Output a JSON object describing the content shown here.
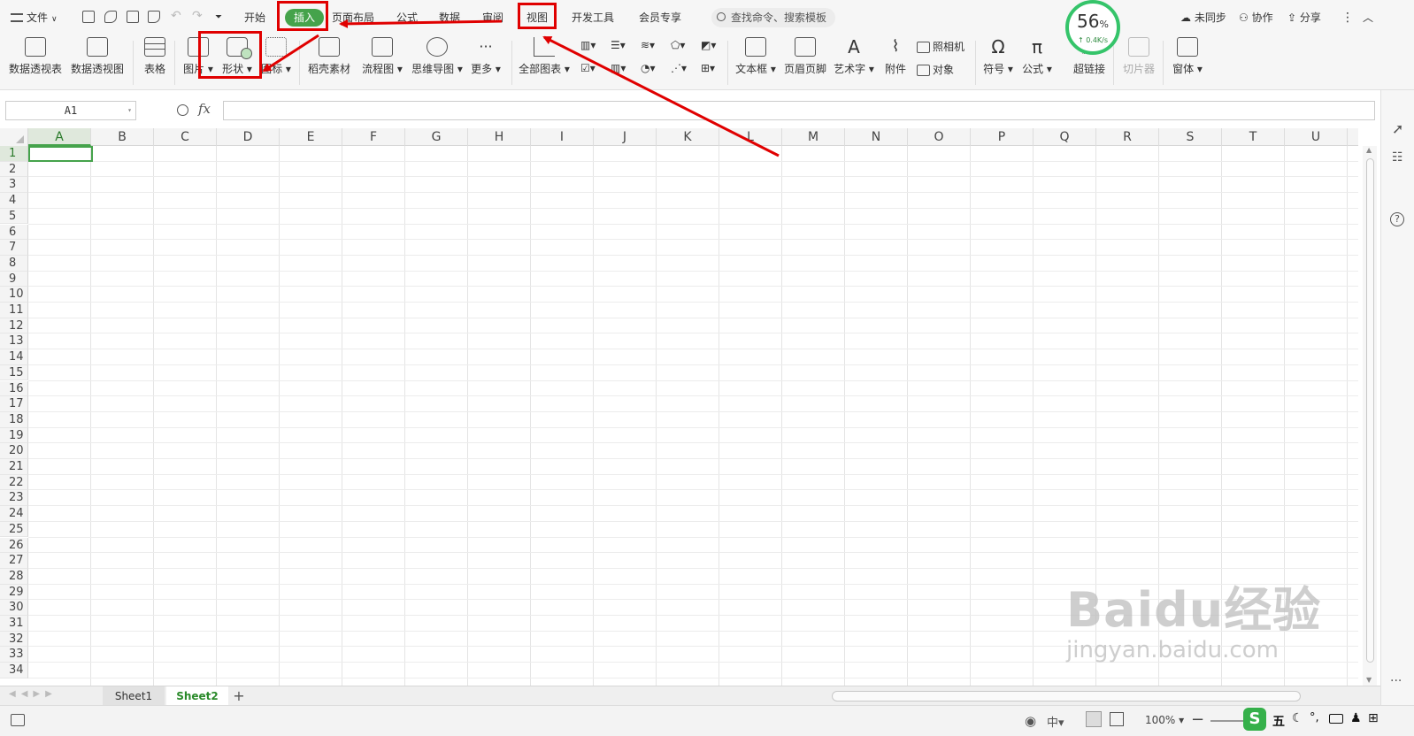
{
  "menubar": {
    "file": "文件",
    "tabs": [
      "开始",
      "插入",
      "页面布局",
      "公式",
      "数据",
      "审阅",
      "视图",
      "开发工具",
      "会员专享"
    ],
    "active_tab": "插入",
    "search_placeholder": "查找命令、搜索模板",
    "sync": "未同步",
    "collab": "协作",
    "share": "分享"
  },
  "speed_widget": {
    "percent": "56",
    "percent_sign": "%",
    "rate": "0.4K/s"
  },
  "ribbon": {
    "pivot_table": "数据透视表",
    "pivot_chart": "数据透视图",
    "table": "表格",
    "picture": "图片",
    "shape": "形状",
    "icon": "图标",
    "straw": "稻壳素材",
    "flowchart": "流程图",
    "mindmap": "思维导图",
    "more": "更多",
    "all_charts": "全部图表",
    "textbox": "文本框",
    "header_footer": "页眉页脚",
    "wordart": "艺术字",
    "attachment": "附件",
    "camera": "照相机",
    "object": "对象",
    "symbol": "符号",
    "formula": "公式",
    "hyperlink": "超链接",
    "slicer": "切片器",
    "window": "窗体"
  },
  "formula_bar": {
    "cell_ref": "A1",
    "fx": "fx",
    "value": ""
  },
  "columns": [
    "A",
    "B",
    "C",
    "D",
    "E",
    "F",
    "G",
    "H",
    "I",
    "J",
    "K",
    "L",
    "M",
    "N",
    "O",
    "P",
    "Q",
    "R",
    "S",
    "T",
    "U"
  ],
  "rows": [
    "1",
    "2",
    "3",
    "4",
    "5",
    "6",
    "7",
    "8",
    "9",
    "10",
    "11",
    "12",
    "13",
    "14",
    "15",
    "16",
    "17",
    "18",
    "19",
    "20",
    "21",
    "22",
    "23",
    "24",
    "25",
    "26",
    "27",
    "28",
    "29",
    "30",
    "31",
    "32",
    "33",
    "34"
  ],
  "sheets": {
    "items": [
      "Sheet1",
      "Sheet2"
    ],
    "active": "Sheet2",
    "add": "+"
  },
  "status": {
    "zoom": "100%",
    "ime": "五"
  },
  "watermark": {
    "logo": "Baidu经验",
    "url": "jingyan.baidu.com"
  },
  "colors": {
    "accent": "#45a34b",
    "annotation": "#e00000"
  }
}
